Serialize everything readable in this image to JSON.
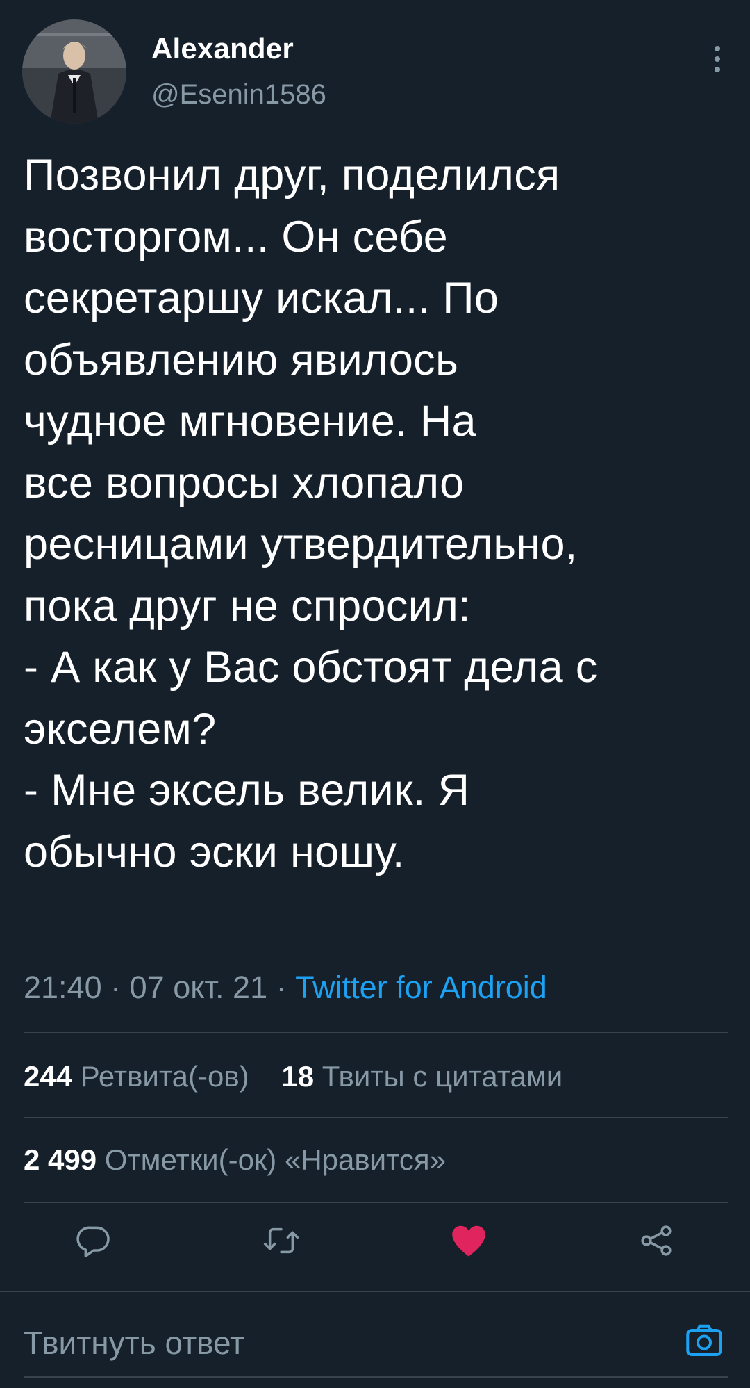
{
  "tweet": {
    "author": {
      "display_name": "Alexander",
      "handle": "@Esenin1586"
    },
    "text": "Позвонил друг, поделился\nвосторгом... Он себе\nсекретаршу искал... По\nобъявлению явилось\nчудное мгновение. На\nвсе вопросы хлопало\nресницами утвердительно,\nпока друг не спросил:\n- А как у Вас обстоят дела с\nэкселем?\n- Мне эксель велик. Я\nобычно эски ношу.",
    "time": "21:40",
    "date": "07 окт. 21",
    "separator": "·",
    "source": "Twitter for Android"
  },
  "stats": {
    "retweets_count": "244",
    "retweets_label": "Ретвита(-ов)",
    "quotes_count": "18",
    "quotes_label": "Твиты с цитатами",
    "likes_count": "2 499",
    "likes_label": "Отметки(-ок) «Нравится»"
  },
  "actions": {
    "reply_icon": "reply-icon",
    "retweet_icon": "retweet-icon",
    "like_icon": "heart-icon",
    "share_icon": "share-icon",
    "liked": true
  },
  "reply_bar": {
    "placeholder": "Твитнуть ответ",
    "camera_icon": "camera-icon"
  },
  "colors": {
    "background": "#15202b",
    "secondary_text": "#8899a6",
    "link": "#1da1f2",
    "like": "#e0245e",
    "divider": "#38444d"
  }
}
